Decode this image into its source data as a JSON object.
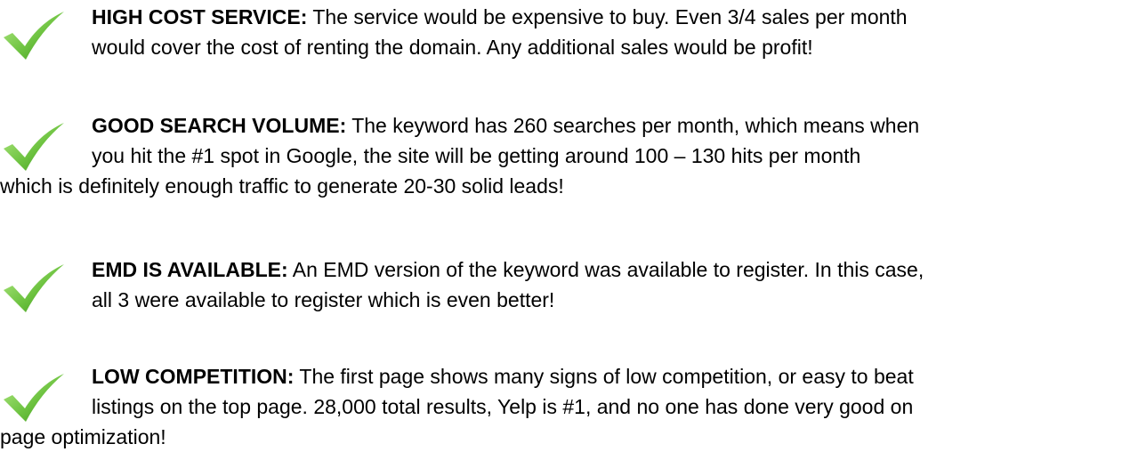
{
  "colors": {
    "check_light": "#9bdc6a",
    "check_dark": "#3f9a22",
    "text": "#000000"
  },
  "items": [
    {
      "icon": "checkmark-icon",
      "label": "HIGH COST SERVICE:",
      "line1": " The service would be expensive to buy.  Even 3/4 sales per month",
      "line2": "would cover the cost of renting the domain.  Any additional sales would be profit!"
    },
    {
      "icon": "checkmark-icon",
      "label": "GOOD SEARCH VOLUME:",
      "line1": " The keyword has 260 searches per month, which means when",
      "line2": "you hit the #1 spot in Google, the site will be getting around 100 – 130 hits per month",
      "line3": "which is definitely enough traffic to generate 20-30 solid leads!"
    },
    {
      "icon": "checkmark-icon",
      "label": "EMD IS AVAILABLE:",
      "line1": " An EMD version of the keyword was available to register.  In this case,",
      "line2": "all 3 were available to register which is even better!"
    },
    {
      "icon": "checkmark-icon",
      "label": "LOW COMPETITION:",
      "line1": " The first page shows many signs of low competition, or easy to beat",
      "line2": "listings on the top page. 28,000 total results, Yelp is #1, and no one has done very good on",
      "line3": "page optimization!"
    }
  ]
}
